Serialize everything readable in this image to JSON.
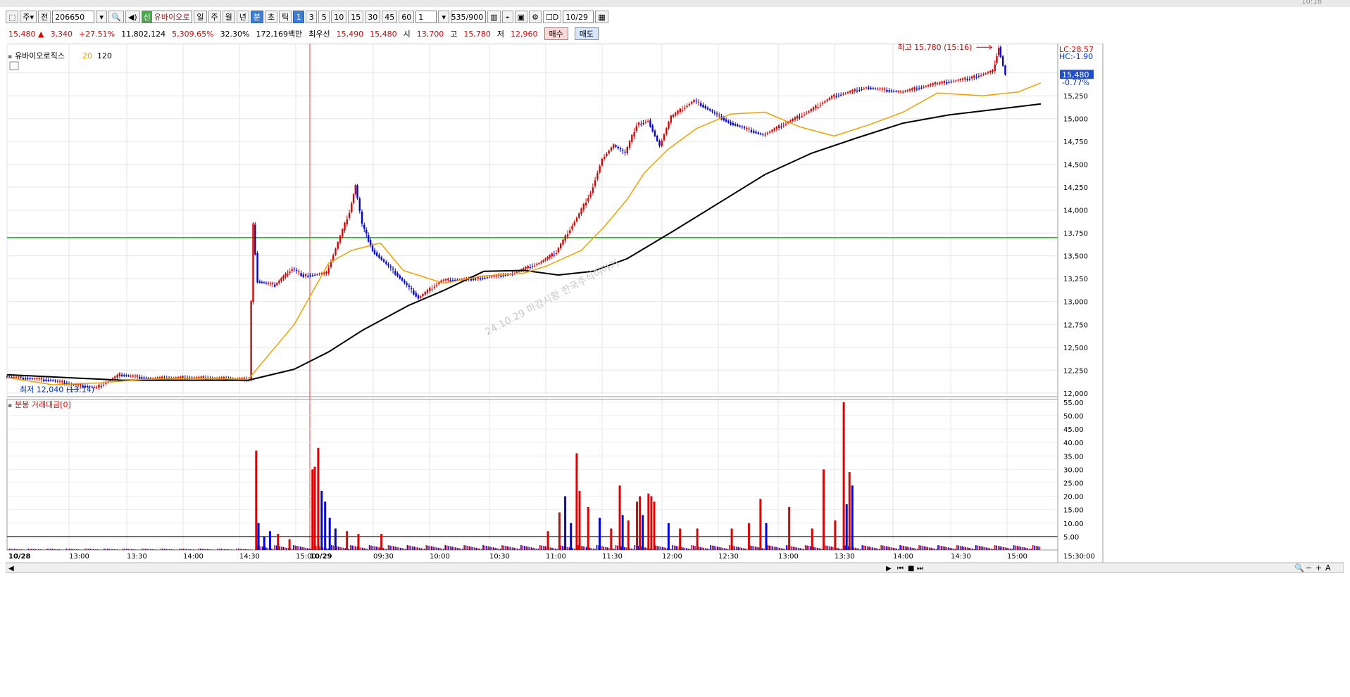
{
  "window": {
    "clock": "10:18"
  },
  "toolbar": {
    "type_label": "주",
    "jeon_label": "전",
    "code": "206650",
    "badge": "신",
    "name": "유바이오로",
    "periods": [
      "일",
      "주",
      "월",
      "년",
      "분",
      "초",
      "틱"
    ],
    "active_period": "분",
    "minute_steps": [
      "1",
      "3",
      "5",
      "10",
      "15",
      "30",
      "45",
      "60"
    ],
    "active_step": "1",
    "multiplier": "1",
    "count": "535",
    "count_max": "/900",
    "date_check_label": "D",
    "date": "10/29"
  },
  "quote": {
    "price": "15,480",
    "arrow": "▲",
    "change": "3,340",
    "change_pct": "+27.51%",
    "volume": "11,802,124",
    "volume_pct": "5,309.65%",
    "turnover_pct": "32.30%",
    "amount": "172,169백만",
    "best_label": "최우선",
    "ask": "15,490",
    "bid": "15,480",
    "open_label": "시",
    "open": "13,700",
    "high_label": "고",
    "high": "15,780",
    "low_label": "저",
    "low": "12,960",
    "buy_label": "매수",
    "sell_label": "매도"
  },
  "price_panel": {
    "title": "유바이오로직스",
    "ma_short": "20",
    "ma_long": "120",
    "lc_label": "LC:28.57",
    "hc_label": "HC:-1.90",
    "current_price": "15,480",
    "current_pct": "-0.77%",
    "high_note": "최고 15,780 (15:16)",
    "low_note": "최저 12,040 (13:14)",
    "watermark": "24.10.29 마감시황 한국주식이야기",
    "colors": {
      "ma20": "#f0a000",
      "ma120": "#000000",
      "hline": "#00cc00",
      "up": "#e00000",
      "down": "#0000e0"
    }
  },
  "volume_panel": {
    "title": "분봉 거래대금[0]"
  },
  "chart_data": [
    {
      "type": "candlestick",
      "title": "유바이오로직스",
      "y_ticks": [
        12000,
        12250,
        12500,
        12750,
        13000,
        13250,
        13500,
        13750,
        14000,
        14250,
        14500,
        14750,
        15000,
        15250,
        15500
      ],
      "ylim": [
        11960,
        15820
      ],
      "horizontal_line": 13700,
      "x_ticks": [
        "10/28",
        "13:00",
        "13:30",
        "14:00",
        "14:30",
        "15:00",
        "10/29",
        "09:30",
        "10:00",
        "10:30",
        "11:00",
        "11:30",
        "12:00",
        "12:30",
        "13:00",
        "13:30",
        "14:00",
        "14:30",
        "15:00",
        "15:30:00"
      ],
      "high": 15780,
      "low": 12040,
      "series": [
        {
          "name": "20",
          "points": [
            [
              0,
              12170
            ],
            [
              80,
              12090
            ],
            [
              160,
              12110
            ],
            [
              240,
              12150
            ],
            [
              330,
              12160
            ],
            [
              420,
              12150
            ],
            [
              500,
              12750
            ],
            [
              560,
              13420
            ],
            [
              600,
              13560
            ],
            [
              650,
              13640
            ],
            [
              690,
              13340
            ],
            [
              760,
              13200
            ],
            [
              830,
              13280
            ],
            [
              900,
              13310
            ],
            [
              940,
              13390
            ],
            [
              1000,
              13560
            ],
            [
              1040,
              13820
            ],
            [
              1080,
              14120
            ],
            [
              1110,
              14410
            ],
            [
              1150,
              14660
            ],
            [
              1200,
              14890
            ],
            [
              1260,
              15050
            ],
            [
              1320,
              15070
            ],
            [
              1380,
              14910
            ],
            [
              1440,
              14810
            ],
            [
              1500,
              14930
            ],
            [
              1560,
              15070
            ],
            [
              1620,
              15280
            ],
            [
              1700,
              15250
            ],
            [
              1760,
              15290
            ],
            [
              1800,
              15390
            ]
          ]
        },
        {
          "name": "120",
          "points": [
            [
              0,
              12200
            ],
            [
              200,
              12140
            ],
            [
              420,
              12140
            ],
            [
              500,
              12260
            ],
            [
              560,
              12450
            ],
            [
              620,
              12690
            ],
            [
              700,
              12960
            ],
            [
              760,
              13120
            ],
            [
              830,
              13330
            ],
            [
              900,
              13340
            ],
            [
              960,
              13290
            ],
            [
              1020,
              13330
            ],
            [
              1080,
              13470
            ],
            [
              1160,
              13770
            ],
            [
              1240,
              14080
            ],
            [
              1320,
              14390
            ],
            [
              1400,
              14620
            ],
            [
              1480,
              14790
            ],
            [
              1560,
              14950
            ],
            [
              1640,
              15040
            ],
            [
              1720,
              15100
            ],
            [
              1800,
              15160
            ]
          ]
        },
        {
          "name": "price",
          "points": [
            [
              0,
              12180
            ],
            [
              80,
              12140
            ],
            [
              120,
              12090
            ],
            [
              160,
              12060
            ],
            [
              200,
              12200
            ],
            [
              250,
              12160
            ],
            [
              330,
              12170
            ],
            [
              425,
              12150
            ],
            [
              432,
              13840
            ],
            [
              440,
              13220
            ],
            [
              470,
              13180
            ],
            [
              500,
              13360
            ],
            [
              520,
              13280
            ],
            [
              560,
              13310
            ],
            [
              600,
              13980
            ],
            [
              610,
              14270
            ],
            [
              622,
              13840
            ],
            [
              640,
              13560
            ],
            [
              680,
              13310
            ],
            [
              720,
              13040
            ],
            [
              760,
              13230
            ],
            [
              820,
              13250
            ],
            [
              880,
              13300
            ],
            [
              930,
              13420
            ],
            [
              960,
              13540
            ],
            [
              1000,
              13960
            ],
            [
              1020,
              14190
            ],
            [
              1040,
              14560
            ],
            [
              1060,
              14710
            ],
            [
              1080,
              14620
            ],
            [
              1100,
              14930
            ],
            [
              1120,
              14980
            ],
            [
              1140,
              14700
            ],
            [
              1160,
              15020
            ],
            [
              1200,
              15200
            ],
            [
              1260,
              14960
            ],
            [
              1320,
              14820
            ],
            [
              1360,
              14950
            ],
            [
              1400,
              15080
            ],
            [
              1440,
              15240
            ],
            [
              1500,
              15340
            ],
            [
              1560,
              15290
            ],
            [
              1620,
              15380
            ],
            [
              1680,
              15440
            ],
            [
              1720,
              15520
            ],
            [
              1730,
              15780
            ],
            [
              1742,
              15480
            ]
          ]
        }
      ]
    },
    {
      "type": "bar",
      "title": "분봉 거래대금[0]",
      "y_ticks": [
        5,
        10,
        15,
        20,
        25,
        30,
        35,
        40,
        45,
        50,
        55
      ],
      "ylim": [
        0,
        56
      ],
      "horizontal_line": 5,
      "bars": [
        [
          432,
          37,
          "up"
        ],
        [
          436,
          10,
          "down"
        ],
        [
          446,
          5,
          "down"
        ],
        [
          456,
          7,
          "down"
        ],
        [
          470,
          6,
          "up"
        ],
        [
          490,
          4,
          "up"
        ],
        [
          530,
          30,
          "up"
        ],
        [
          534,
          31,
          "up"
        ],
        [
          540,
          38,
          "up"
        ],
        [
          546,
          22,
          "down"
        ],
        [
          552,
          18,
          "down"
        ],
        [
          560,
          12,
          "down"
        ],
        [
          570,
          8,
          "down"
        ],
        [
          590,
          7,
          "up"
        ],
        [
          610,
          6,
          "up"
        ],
        [
          650,
          6,
          "up"
        ],
        [
          940,
          7,
          "up"
        ],
        [
          960,
          14,
          "up"
        ],
        [
          970,
          20,
          "down"
        ],
        [
          980,
          10,
          "down"
        ],
        [
          990,
          36,
          "up"
        ],
        [
          995,
          22,
          "up"
        ],
        [
          1010,
          16,
          "up"
        ],
        [
          1030,
          12,
          "down"
        ],
        [
          1050,
          8,
          "up"
        ],
        [
          1065,
          24,
          "up"
        ],
        [
          1070,
          13,
          "down"
        ],
        [
          1080,
          11,
          "up"
        ],
        [
          1095,
          18,
          "up"
        ],
        [
          1100,
          20,
          "up"
        ],
        [
          1105,
          13,
          "down"
        ],
        [
          1115,
          21,
          "up"
        ],
        [
          1120,
          20,
          "up"
        ],
        [
          1125,
          18,
          "up"
        ],
        [
          1150,
          10,
          "down"
        ],
        [
          1170,
          8,
          "up"
        ],
        [
          1200,
          8,
          "up"
        ],
        [
          1260,
          8,
          "up"
        ],
        [
          1290,
          10,
          "up"
        ],
        [
          1310,
          19,
          "up"
        ],
        [
          1320,
          10,
          "down"
        ],
        [
          1360,
          16,
          "up"
        ],
        [
          1400,
          8,
          "up"
        ],
        [
          1420,
          30,
          "up"
        ],
        [
          1440,
          11,
          "up"
        ],
        [
          1455,
          55,
          "up"
        ],
        [
          1460,
          17,
          "down"
        ],
        [
          1465,
          29,
          "up"
        ],
        [
          1470,
          24,
          "down"
        ]
      ]
    }
  ]
}
